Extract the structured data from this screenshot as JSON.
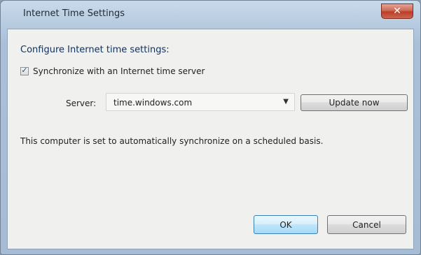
{
  "window": {
    "title": "Internet Time Settings",
    "close_glyph": "✕"
  },
  "content": {
    "heading": "Configure Internet time settings:",
    "sync_checkbox": {
      "label": "Synchronize with an Internet time server",
      "checked": true,
      "mark": "✓"
    },
    "server": {
      "label": "Server:",
      "value": "time.windows.com",
      "arrow_glyph": "▼"
    },
    "update_button_label": "Update now",
    "status_text": "This computer is set to automatically synchronize on a scheduled basis."
  },
  "footer": {
    "ok_label": "OK",
    "cancel_label": "Cancel"
  },
  "colors": {
    "title_gradient_top": "#c9daea",
    "client_bg": "#f0f0ee",
    "close_button": "#cf6b55",
    "heading_text": "#10305a",
    "ok_button_border": "#3c7fb1"
  },
  "icons": {
    "close": "close-icon",
    "checkbox": "checkmark-icon",
    "dropdown": "chevron-down-icon"
  }
}
